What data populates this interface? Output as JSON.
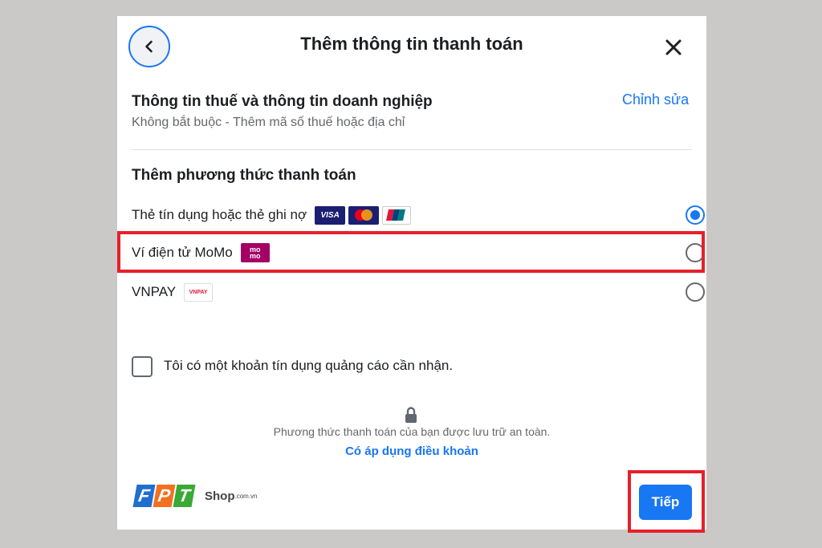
{
  "dialog": {
    "title": "Thêm thông tin thanh toán",
    "back_icon": "chevron-left-icon",
    "close_icon": "close-icon"
  },
  "tax": {
    "title": "Thông tin thuế và thông tin doanh nghiệp",
    "subtitle": "Không bắt buộc - Thêm mã số thuế hoặc địa chỉ",
    "edit_label": "Chỉnh sửa"
  },
  "payment": {
    "section_title": "Thêm phương thức thanh toán",
    "options": [
      {
        "label": "Thẻ tín dụng hoặc thẻ ghi nợ",
        "selected": true,
        "logos": [
          "VISA",
          "mastercard",
          "UnionPay"
        ]
      },
      {
        "label": "Ví điện tử MoMo",
        "selected": false,
        "logos": [
          "mo mo"
        ]
      },
      {
        "label": "VNPAY",
        "selected": false,
        "logos": [
          "VNPAY"
        ]
      }
    ]
  },
  "credit_checkbox": {
    "label": "Tôi có một khoản tín dụng quảng cáo cần nhận.",
    "checked": false
  },
  "security": {
    "icon": "lock-icon",
    "text": "Phương thức thanh toán của bạn được lưu trữ an toàn.",
    "terms_link": "Có áp dụng điều khoản"
  },
  "brand": {
    "letters": [
      "F",
      "P",
      "T"
    ],
    "shop": "Shop",
    "shop_suffix": ".com.vn"
  },
  "footer": {
    "next_label": "Tiếp"
  },
  "colors": {
    "accent": "#1877f2",
    "highlight": "#e5202b",
    "momo": "#a50064",
    "visa": "#1a1f71"
  }
}
